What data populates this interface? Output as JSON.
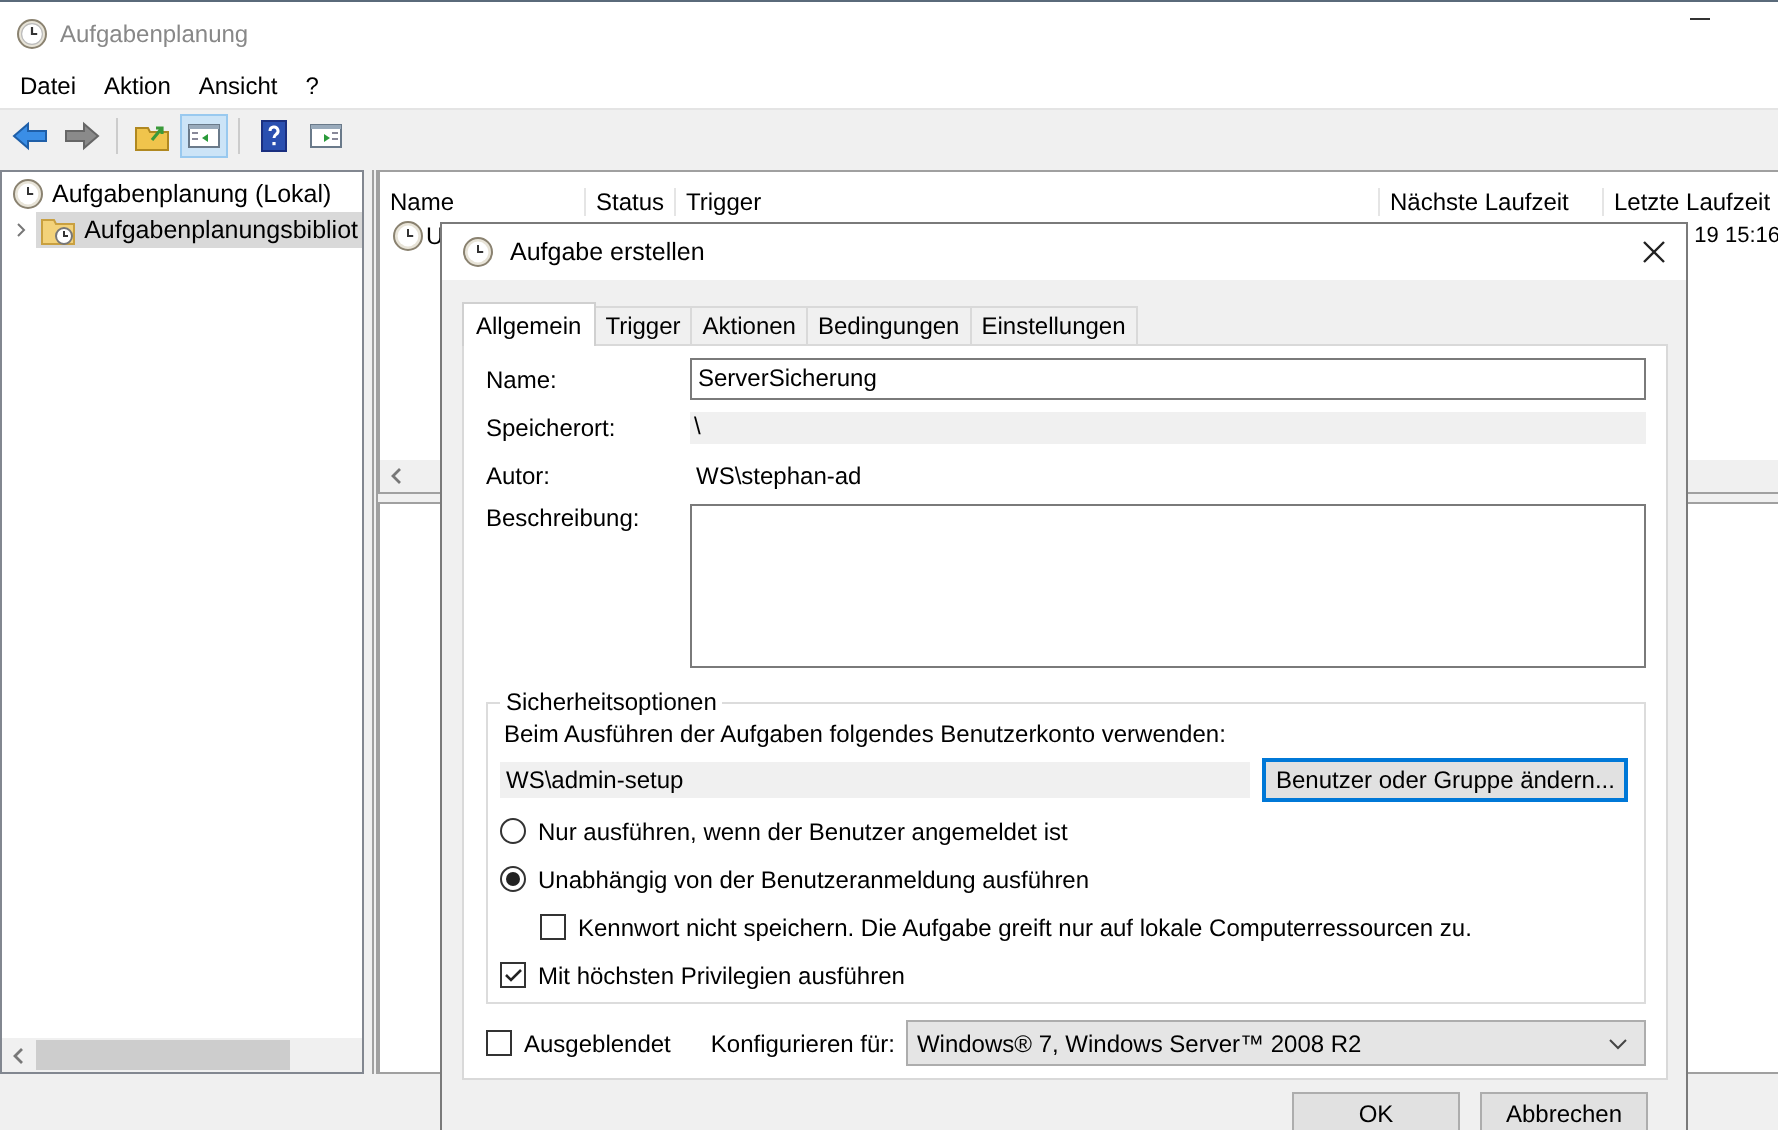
{
  "window": {
    "title": "Aufgabenplanung"
  },
  "menu": [
    "Datei",
    "Aktion",
    "Ansicht",
    "?"
  ],
  "tree": [
    {
      "label": "Aufgabenplanung (Lokal)",
      "selected": false,
      "children": [
        {
          "label": "Aufgabenplanungsbibliot",
          "selected": true,
          "expanded": false
        }
      ]
    }
  ],
  "task_list": {
    "columns": [
      "Name",
      "Status",
      "Trigger",
      "Nächste Laufzeit",
      "Letzte Laufzeit"
    ],
    "rows": [
      {
        "name": "U",
        "last_run": "19 15:16"
      }
    ]
  },
  "dialog": {
    "title": "Aufgabe erstellen",
    "tabs": [
      {
        "label": "Allgemein",
        "selected": true
      },
      {
        "label": "Trigger",
        "selected": false
      },
      {
        "label": "Aktionen",
        "selected": false
      },
      {
        "label": "Bedingungen",
        "selected": false
      },
      {
        "label": "Einstellungen",
        "selected": false
      }
    ],
    "name_label": "Name:",
    "name_value": "ServerSicherung",
    "location_label": "Speicherort:",
    "location_value": "\\",
    "author_label": "Autor:",
    "author_value": "WS\\stephan-ad",
    "description_label": "Beschreibung:",
    "security": {
      "legend": "Sicherheitsoptionen",
      "account_prompt": "Beim Ausführen der Aufgaben folgendes Benutzerkonto verwenden:",
      "account": "WS\\admin-setup",
      "change_button": "Benutzer oder Gruppe ändern...",
      "options": [
        {
          "kind": "radio",
          "label": "Nur ausführen, wenn der Benutzer angemeldet ist",
          "selected": false
        },
        {
          "kind": "radio",
          "label": "Unabhängig von der Benutzeranmeldung ausführen",
          "selected": true,
          "children": [
            {
              "kind": "checkbox",
              "label": "Kennwort nicht speichern. Die Aufgabe greift nur auf lokale Computerressourcen zu.",
              "checked": false
            }
          ]
        },
        {
          "kind": "checkbox",
          "label": "Mit höchsten Privilegien ausführen",
          "checked": true
        }
      ]
    },
    "hidden": {
      "label": "Ausgeblendet",
      "checked": false
    },
    "configure_label": "Konfigurieren für:",
    "configure_value": "Windows® 7, Windows Server™ 2008 R2",
    "buttons": [
      "OK",
      "Abbrechen"
    ]
  }
}
